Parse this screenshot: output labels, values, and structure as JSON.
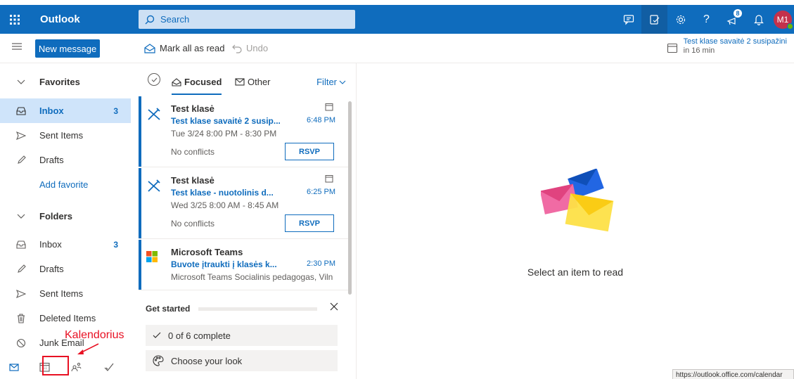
{
  "topbar": {
    "app_name": "Outlook",
    "search_placeholder": "Search",
    "badge_count": "8",
    "avatar_initials": "M1"
  },
  "commandbar": {
    "new_message": "New message",
    "mark_all_read": "Mark all as read",
    "undo": "Undo",
    "reminder_title": "Test klase savaitė 2 susipažini",
    "reminder_sub": "in 16 min"
  },
  "sidebar": {
    "favorites_label": "Favorites",
    "favorites": [
      {
        "label": "Inbox",
        "count": "3"
      },
      {
        "label": "Sent Items",
        "count": ""
      },
      {
        "label": "Drafts",
        "count": ""
      }
    ],
    "add_favorite": "Add favorite",
    "folders_label": "Folders",
    "folders": [
      {
        "label": "Inbox",
        "count": "3"
      },
      {
        "label": "Drafts",
        "count": ""
      },
      {
        "label": "Sent Items",
        "count": ""
      },
      {
        "label": "Deleted Items",
        "count": ""
      },
      {
        "label": "Junk Email",
        "count": ""
      }
    ],
    "annotation": "Kalendorius"
  },
  "list": {
    "tab_focused": "Focused",
    "tab_other": "Other",
    "filter": "Filter",
    "messages": [
      {
        "sender": "Test klasė",
        "subject": "Test klase savaitė 2 susip...",
        "time": "6:48 PM",
        "preview": "Tue 3/24 8:00 PM - 8:30 PM",
        "conflicts": "No conflicts",
        "rsvp": "RSVP"
      },
      {
        "sender": "Test klasė",
        "subject": "Test klase - nuotolinis d...",
        "time": "6:25 PM",
        "preview": "Wed 3/25 8:00 AM - 8:45 AM",
        "conflicts": "No conflicts",
        "rsvp": "RSVP"
      },
      {
        "sender": "Microsoft Teams",
        "subject": "Buvote įtraukti į klasės k...",
        "time": "2:30 PM",
        "preview": "Microsoft Teams Socialinis pedagogas, Viln"
      }
    ],
    "get_started": {
      "title": "Get started",
      "items": [
        "0 of 6 complete",
        "Choose your look"
      ]
    }
  },
  "reading": {
    "empty_text": "Select an item to read"
  },
  "status_url": "https://outlook.office.com/calendar"
}
